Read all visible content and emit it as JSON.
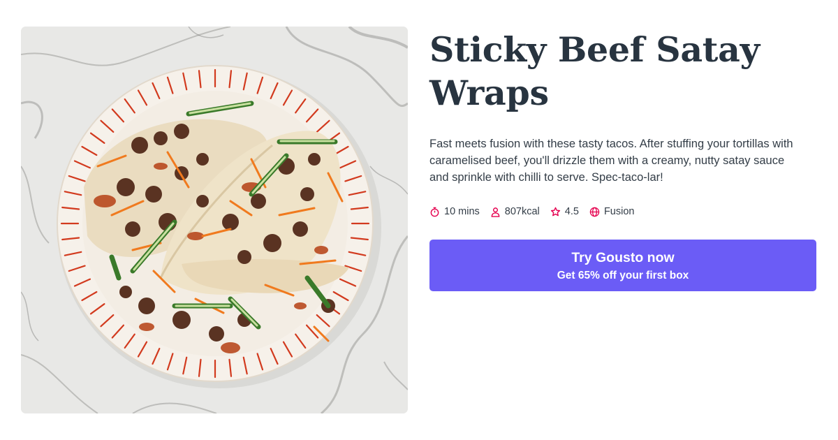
{
  "recipe": {
    "title": "Sticky Beef Satay Wraps",
    "description": "Fast meets fusion with these tasty tacos. After stuffing your tortillas with caramelised beef, you'll drizzle them with a creamy, nutty satay sauce and sprinkle with chilli to serve. Spec-taco-lar!",
    "meta": {
      "time": "10 mins",
      "calories": "807kcal",
      "rating": "4.5",
      "cuisine": "Fusion"
    }
  },
  "cta": {
    "main_label": "Try Gousto now",
    "sub_label": "Get 65% off your first box"
  },
  "icons": {
    "time": "stopwatch-icon",
    "calories": "person-icon",
    "rating": "star-icon",
    "cuisine": "globe-icon"
  },
  "colors": {
    "accent": "#e5004f",
    "cta_background": "#6b5cf6",
    "title": "#283440",
    "text": "#333d47"
  }
}
